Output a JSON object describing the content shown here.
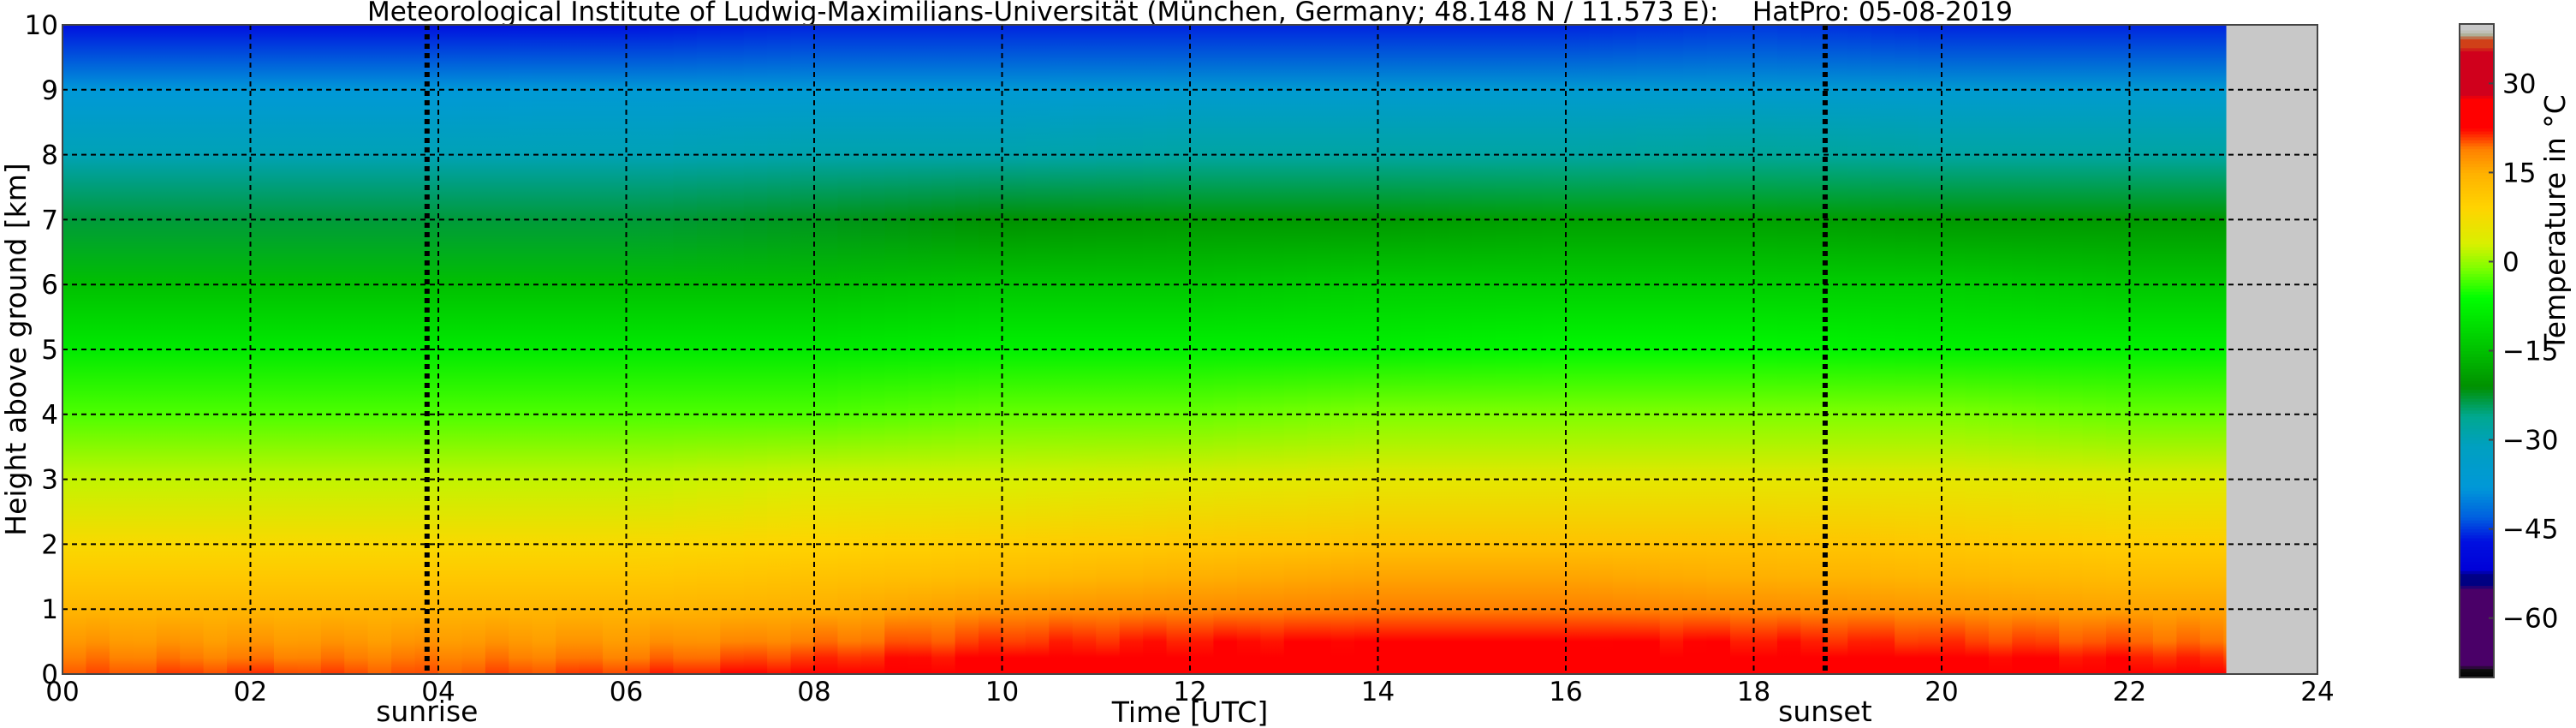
{
  "chart_data": {
    "type": "heatmap",
    "title": "Meteorological Institute of Ludwig-Maximilians-Universität (München, Germany; 48.148 N / 11.573 E):    HatPro: 05-08-2019",
    "xlabel": "Time [UTC]",
    "ylabel": "Height above ground [km]",
    "xlim": [
      0,
      24
    ],
    "ylim": [
      0,
      10
    ],
    "x_ticks": [
      "00",
      "02",
      "04",
      "06",
      "08",
      "10",
      "12",
      "14",
      "16",
      "18",
      "20",
      "22",
      "24"
    ],
    "y_ticks": [
      "0",
      "1",
      "2",
      "3",
      "4",
      "5",
      "6",
      "7",
      "8",
      "9",
      "10"
    ],
    "grid": true,
    "data_end_hour": 23.03,
    "no_data_color": "#c8c8c8",
    "annotations": [
      {
        "label": "sunrise",
        "x": 3.88
      },
      {
        "label": "sunset",
        "x": 18.76
      }
    ],
    "colorbar": {
      "label": "Temperature in °C",
      "range": [
        -70,
        40
      ],
      "ticks": [
        "30",
        "15",
        "0",
        "−15",
        "−30",
        "−45",
        "−60"
      ],
      "tick_values": [
        30,
        15,
        0,
        -15,
        -30,
        -45,
        -60
      ]
    },
    "colormap": [
      [
        -70,
        "#000000"
      ],
      [
        -68.5,
        "#101010"
      ],
      [
        -68,
        "#4a0068"
      ],
      [
        -55,
        "#4a0068"
      ],
      [
        -54.5,
        "#000080"
      ],
      [
        -52.5,
        "#000088"
      ],
      [
        -52,
        "#0000d8"
      ],
      [
        -47,
        "#0010e0"
      ],
      [
        -43,
        "#0060e0"
      ],
      [
        -38,
        "#0098d8"
      ],
      [
        -31,
        "#00a0c0"
      ],
      [
        -26,
        "#00a890"
      ],
      [
        -21,
        "#009000"
      ],
      [
        -15,
        "#00c000"
      ],
      [
        -6,
        "#00ff00"
      ],
      [
        -1,
        "#80ff00"
      ],
      [
        3,
        "#d8f000"
      ],
      [
        9,
        "#ffd400"
      ],
      [
        15,
        "#ffb000"
      ],
      [
        19,
        "#ff8000"
      ],
      [
        22.5,
        "#ff0000"
      ],
      [
        27.5,
        "#ff0000"
      ],
      [
        28,
        "#d0001c"
      ],
      [
        35.5,
        "#d0001c"
      ],
      [
        36,
        "#d04018"
      ],
      [
        37.5,
        "#d04018"
      ],
      [
        38,
        "#a8a888"
      ],
      [
        39,
        "#c8c8c8"
      ],
      [
        40,
        "#c8c8c8"
      ]
    ],
    "times": [
      0,
      2,
      4,
      6,
      8,
      10,
      12,
      14,
      16,
      18,
      20,
      22,
      23
    ],
    "heights": [
      0,
      0.25,
      0.5,
      1,
      1.5,
      2,
      3,
      4,
      5,
      6,
      7,
      8,
      9,
      10
    ],
    "temperature": [
      [
        20,
        21,
        20,
        21,
        23,
        25,
        26,
        27,
        27,
        25,
        24,
        24,
        23
      ],
      [
        19,
        19,
        19,
        19,
        21,
        23,
        24,
        25,
        25,
        24,
        23,
        22,
        21
      ],
      [
        17,
        17,
        17,
        17,
        19,
        21,
        22,
        23,
        23,
        22,
        21,
        20,
        19
      ],
      [
        14,
        14,
        14,
        14,
        15,
        17,
        18,
        19,
        19,
        18,
        17,
        16,
        16
      ],
      [
        11,
        11,
        11,
        11,
        12,
        13,
        15,
        16,
        16,
        15,
        14,
        13,
        13
      ],
      [
        8,
        8,
        8,
        8,
        9,
        10,
        11,
        12,
        12,
        12,
        11,
        10,
        10
      ],
      [
        2,
        2,
        2,
        2,
        3,
        3,
        4,
        5,
        5,
        5,
        5,
        4,
        4
      ],
      [
        -3,
        -3,
        -3,
        -3,
        -3,
        -2,
        -2,
        -1,
        -1,
        -1,
        -1,
        -2,
        -2
      ],
      [
        -9,
        -9,
        -9,
        -9,
        -9,
        -8,
        -8,
        -8,
        -7,
        -7,
        -8,
        -8,
        -8
      ],
      [
        -15,
        -15,
        -15,
        -15,
        -15,
        -14,
        -14,
        -13,
        -13,
        -13,
        -13,
        -14,
        -14
      ],
      [
        -23,
        -23,
        -23,
        -23,
        -22,
        -21,
        -20,
        -20,
        -19,
        -19,
        -20,
        -20,
        -20
      ],
      [
        -30,
        -30,
        -30,
        -30,
        -29,
        -29,
        -28,
        -28,
        -28,
        -27,
        -28,
        -28,
        -28
      ],
      [
        -38,
        -38,
        -38,
        -37,
        -37,
        -37,
        -36,
        -36,
        -36,
        -36,
        -36,
        -36,
        -36
      ],
      [
        -47,
        -47,
        -47,
        -47,
        -46,
        -46,
        -46,
        -46,
        -46,
        -45,
        -46,
        -46,
        -46
      ]
    ]
  }
}
